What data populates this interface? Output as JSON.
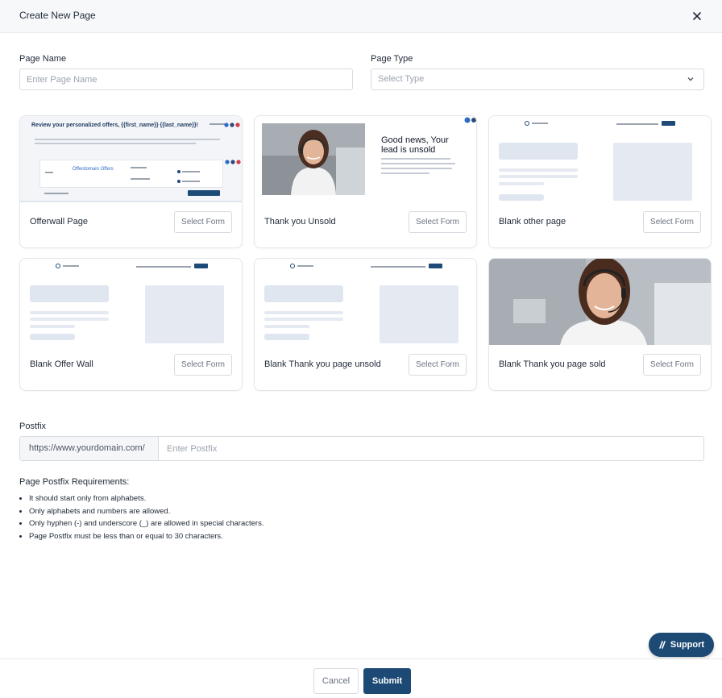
{
  "header": {
    "title": "Create New Page",
    "close_icon": "close-icon"
  },
  "form": {
    "page_name_label": "Page Name",
    "page_name_placeholder": "Enter Page Name",
    "page_type_label": "Page Type",
    "page_type_placeholder": "Select Type"
  },
  "templates": [
    {
      "title": "Offerwall Page",
      "button": "Select Form",
      "thumb": {
        "heading": "Review your personalized offers, {{first_name}} {{last_name}}!",
        "brand": "Offerdomain Offers"
      }
    },
    {
      "title": "Thank you Unsold",
      "button": "Select Form",
      "thumb": {
        "heading": "Good news, Your lead is unsold"
      }
    },
    {
      "title": "Blank other page",
      "button": "Select Form"
    },
    {
      "title": "Blank Offer Wall",
      "button": "Select Form"
    },
    {
      "title": "Blank Thank you page unsold",
      "button": "Select Form"
    },
    {
      "title": "Blank Thank you page sold",
      "button": "Select Form"
    }
  ],
  "postfix": {
    "label": "Postfix",
    "prefix": "https://www.yourdomain.com/",
    "placeholder": "Enter Postfix"
  },
  "requirements": {
    "title": "Page Postfix Requirements:",
    "items": [
      "It should start only from alphabets.",
      "Only alphabets and numbers are allowed.",
      "Only hyphen (-) and underscore (_) are allowed in special characters.",
      "Page Postfix must be less than or equal to 30 characters."
    ]
  },
  "support": {
    "label": "Support"
  },
  "footer": {
    "cancel": "Cancel",
    "submit": "Submit"
  },
  "colors": {
    "primary": "#1c4a74",
    "border": "#d6dae1",
    "placeholder_block": "#dfe6ef"
  }
}
